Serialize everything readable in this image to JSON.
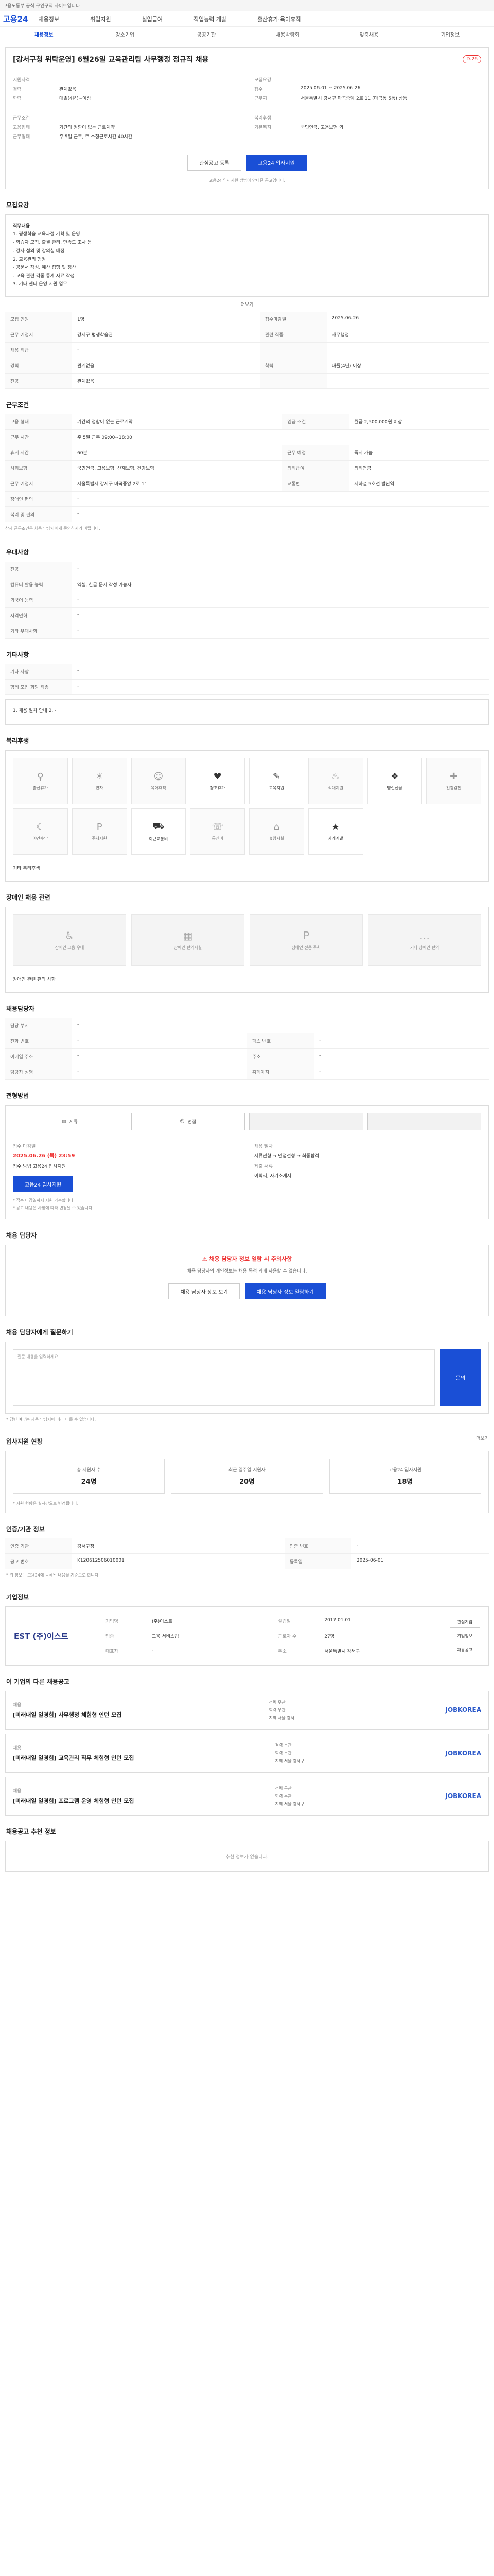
{
  "topbar": {
    "text": "고용노동부 공식 구인구직 사이트입니다"
  },
  "logo": "고용24",
  "nav": [
    "채용정보",
    "취업지원",
    "실업급여",
    "직업능력 개발",
    "출산휴가·육아휴직"
  ],
  "subnav": {
    "items": [
      "채용정보",
      "강소기업",
      "공공기관",
      "채용박람회",
      "맞춤채용",
      "기업정보"
    ],
    "active": 0
  },
  "job": {
    "title": "[강서구청 위탁운영] 6월26일 교육관리팀 사무행정 정규직 채용",
    "dday": "D-26",
    "left_title": "지원자격",
    "left": [
      [
        "경력",
        "관계없음"
      ],
      [
        "학력",
        "대졸(4년)~이상"
      ]
    ],
    "right_title": "모집요강",
    "right": [
      [
        "접수",
        "2025.06.01 ~ 2025.06.26"
      ],
      [
        "근무지",
        "서울특별시 강서구 마곡중앙 2로 11 (마곡동 5동) 상동"
      ]
    ],
    "cond_title": "근무조건",
    "cond": [
      [
        "고용형태",
        "기간의 정함이 없는 근로계약"
      ],
      [
        "근무형태",
        "주 5일 근무, 주 소정근로시간 40시간"
      ]
    ],
    "welfare_title": "복리후생",
    "welfare": [
      [
        "기본복지",
        "국민연금, 고용보험 외"
      ]
    ],
    "btn_scrap": "관심공고 등록",
    "btn_apply": "고용24 입사지원",
    "note": "고용24 입사지원 방법이 안내된 공고입니다."
  },
  "recruit": {
    "title": "모집요강",
    "body": [
      "직무내용",
      "1. 평생학습 교육과정 기획 및 운영",
      "- 학습자 모집, 출결 관리, 만족도 조사 등",
      "- 강사 섭외 및 강의실 배정",
      "2. 교육관리 행정",
      "- 공문서 작성, 예산 집행 및 정산",
      "- 교육 관련 각종 통계 자료 작성",
      "3. 기타 센터 운영 지원 업무"
    ],
    "more": "더보기",
    "rows": [
      [
        "모집 인원",
        "1명",
        "접수마감일",
        "2025-06-26"
      ],
      [
        "근무 예정지",
        "강서구 평생학습관",
        "관련 직종",
        "사무행정"
      ],
      [
        "채용 직급",
        "-",
        "",
        ""
      ],
      [
        "경력",
        "관계없음",
        "학력",
        "대졸(4년) 이상"
      ],
      [
        "전공",
        "관계없음",
        "",
        ""
      ]
    ]
  },
  "work": {
    "title": "근무조건",
    "rows": [
      [
        "고용 형태",
        "기간의 정함이 없는 근로계약",
        "임금 조건",
        "월급 2,500,000원 이상"
      ],
      [
        "근무 시간",
        "주 5일 근무 09:00~18:00",
        "",
        ""
      ],
      [
        "휴게 시간",
        "60분",
        "근무 예정",
        "즉시 가능"
      ],
      [
        "사회보험",
        "국민연금, 고용보험, 산재보험, 건강보험",
        "퇴직급여",
        "퇴직연금"
      ],
      [
        "근무 예정지",
        "서울특별시 강서구 마곡중앙 2로 11",
        "교통편",
        "지하철 5호선 발산역"
      ],
      [
        "장애인 편의",
        "-",
        "",
        ""
      ],
      [
        "복리 및 편의",
        "-",
        "",
        ""
      ]
    ],
    "note": "상세 근무조건은 채용 담당자에게 문의하시기 바랍니다."
  },
  "apply_docs": {
    "title": "우대사항",
    "rows": [
      [
        "전공",
        "-"
      ],
      [
        "컴퓨터 활용 능력",
        "엑셀, 한글 문서 작성 가능자"
      ],
      [
        "외국어 능력",
        "-"
      ],
      [
        "자격면허",
        "-"
      ],
      [
        "기타 우대사항",
        "-"
      ]
    ]
  },
  "extra": {
    "title": "기타사항",
    "rows": [
      [
        "기타 사항",
        "-"
      ],
      [
        "함께 모집 희망 직종",
        "-"
      ]
    ],
    "box": "1. 채용 절차 안내 2. -"
  },
  "welfare": {
    "title": "복리후생",
    "icons": [
      "출산휴가",
      "연차",
      "육아휴직",
      "경조휴가",
      "교육지원",
      "식대지원",
      "명절선물",
      "건강검진",
      "야간수당",
      "주차지원",
      "야근교통비",
      "통신비",
      "휴양시설",
      "자기계발"
    ],
    "active": [
      3,
      4,
      6,
      10,
      13
    ],
    "text": "기타 복리후생"
  },
  "disabled": {
    "title": "장애인 채용 관련",
    "cells": [
      "장애인 고용 우대",
      "장애인 편의시설",
      "장애인 전용 주차",
      "기타 장애인 편의"
    ],
    "text": "장애인 관련 편의 사항"
  },
  "contact": {
    "title": "채용담당자",
    "rows": [
      [
        "담당 부서",
        "-",
        "",
        ""
      ],
      [
        "전화 번호",
        "-",
        "팩스 번호",
        "-"
      ],
      [
        "이메일 주소",
        "-",
        "주소",
        "-"
      ],
      [
        "담당자 성명",
        "-",
        "홈페이지",
        "-"
      ]
    ]
  },
  "method": {
    "title": "전형방법",
    "items": [
      "서류",
      "면접",
      "",
      ""
    ],
    "deadline_label": "접수 마감일",
    "deadline": "2025.06.26 (목) 23:59",
    "left": [
      "접수 방법 고용24 입사지원"
    ],
    "right": [
      "채용 절차",
      "서류전형 → 면접전형 → 최종합격",
      "제출 서류",
      "이력서, 자기소개서"
    ],
    "btn": "고용24 입사지원",
    "notes": [
      "* 접수 마감일까지 지원 가능합니다.",
      "* 공고 내용은 사정에 따라 변경될 수 있습니다."
    ]
  },
  "warn": {
    "title": "채용 담당자",
    "head": "채용 담당자 정보 열람 시 주의사항",
    "text": "채용 담당자의 개인정보는 채용 목적 외에 사용할 수 없습니다.",
    "btn1": "채용 담당자 정보 보기",
    "btn2": "채용 담당자 정보 열람하기"
  },
  "qa": {
    "title": "채용 담당자에게 질문하기",
    "placeholder": "질문 내용을 입력하세요.",
    "btn": "문의",
    "notes": [
      "* 답변 여부는 채용 담당자에 따라 다를 수 있습니다."
    ]
  },
  "stats": {
    "title": "입사지원 현황",
    "more": "더보기",
    "items": [
      [
        "총 지원자 수",
        "24명"
      ],
      [
        "최근 일주일 지원자",
        "20명"
      ],
      [
        "고용24 입사지원",
        "18명"
      ]
    ],
    "note": "* 지원 현황은 실시간으로 변경됩니다."
  },
  "agency": {
    "title": "인증/기관 정보",
    "rows": [
      [
        "인증 기관",
        "강서구청",
        "인증 번호",
        "-"
      ],
      [
        "공고 번호",
        "K120612506010001",
        "등록일",
        "2025-06-01"
      ]
    ],
    "notes": [
      "* 위 정보는 고용24에 등록된 내용을 기준으로 합니다."
    ]
  },
  "company": {
    "title": "기업정보",
    "logo": "EST (주)이스트",
    "info": [
      [
        "기업명",
        "(주)이스트"
      ],
      [
        "업종",
        "교육 서비스업"
      ],
      [
        "대표자",
        "-"
      ],
      [
        "근로자 수",
        "27명"
      ],
      [
        "주소",
        "서울특별시 강서구"
      ],
      [
        "설립일",
        "2017.01.01"
      ]
    ],
    "btns": [
      "관심기업",
      "기업정보",
      "채용공고"
    ]
  },
  "related": {
    "title": "이 기업의 다른 채용공고",
    "items": [
      {
        "label": "채용",
        "title": "[미래내일 일경험] 사무행정 체험형 인턴 모집",
        "meta": [
          "경력 무관",
          "학력 무관",
          "지역 서울 강서구"
        ],
        "logo": "JOBKOREA"
      },
      {
        "label": "채용",
        "title": "[미래내일 일경험] 교육관리 직무 체험형 인턴 모집",
        "meta": [
          "경력 무관",
          "학력 무관",
          "지역 서울 강서구"
        ],
        "logo": "JOBKOREA"
      },
      {
        "label": "채용",
        "title": "[미래내일 일경험] 프로그램 운영 체험형 인턴 모집",
        "meta": [
          "경력 무관",
          "학력 무관",
          "지역 서울 강서구"
        ],
        "logo": "JOBKOREA"
      }
    ]
  },
  "footer": {
    "title": "채용공고 추천 정보",
    "text": "추천 정보가 없습니다."
  }
}
